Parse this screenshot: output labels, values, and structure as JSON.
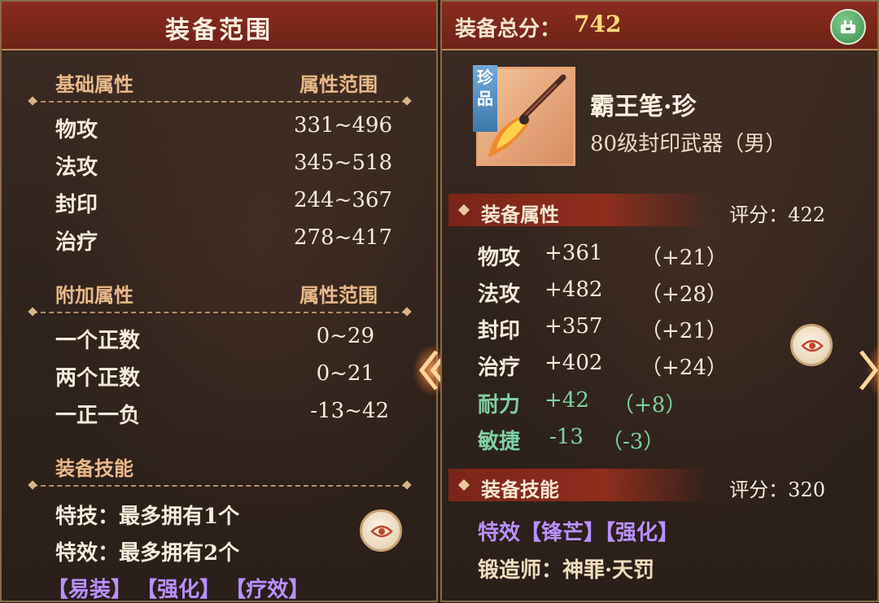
{
  "left_panel": {
    "title": "装备范围",
    "basic": {
      "header_left": "基础属性",
      "header_right": "属性范围",
      "rows": [
        {
          "label": "物攻",
          "value": "331~496"
        },
        {
          "label": "法攻",
          "value": "345~518"
        },
        {
          "label": "封印",
          "value": "244~367"
        },
        {
          "label": "治疗",
          "value": "278~417"
        }
      ]
    },
    "extra": {
      "header_left": "附加属性",
      "header_right": "属性范围",
      "rows": [
        {
          "label": "一个正数",
          "value": "0~29"
        },
        {
          "label": "两个正数",
          "value": "0~21"
        },
        {
          "label": "一正一负",
          "value": "-13~42"
        }
      ]
    },
    "skills": {
      "header": "装备技能",
      "lines": [
        "特技：最多拥有1个",
        "特效：最多拥有2个"
      ],
      "tags": [
        "【易装】",
        "【强化】",
        "【疗效】"
      ]
    }
  },
  "right_panel": {
    "score_label": "装备总分：",
    "score_value": "742",
    "item": {
      "rarity": "珍品",
      "name": "霸王笔·珍",
      "description": "80级封印武器（男）"
    },
    "attributes": {
      "header": "装备属性",
      "score": "评分：422",
      "rows": [
        {
          "label": "物攻",
          "value": "+361",
          "bonus": "（+21）",
          "highlight": false
        },
        {
          "label": "法攻",
          "value": "+482",
          "bonus": "（+28）",
          "highlight": false
        },
        {
          "label": "封印",
          "value": "+357",
          "bonus": "（+21）",
          "highlight": false
        },
        {
          "label": "治疗",
          "value": "+402",
          "bonus": "（+24）",
          "highlight": false
        },
        {
          "label": "耐力",
          "value": "+42",
          "bonus": "（+8）",
          "highlight": true
        },
        {
          "label": "敏捷",
          "value": "-13",
          "bonus": "（-3）",
          "highlight": true
        }
      ]
    },
    "skills": {
      "header": "装备技能",
      "score": "评分：320",
      "effect_line": "特效【锋芒】【强化】",
      "smith_line": "锻造师：神罪·天罚"
    }
  },
  "colors": {
    "header_red": "#8a2c1e",
    "section_gold": "#e8b98a",
    "tag_purple": "#b991ff",
    "stat_green": "#7fd0a5",
    "score_gold": "#ffd67a"
  },
  "icons": [
    "settings-icon",
    "eye-icon",
    "arrow-left-icon",
    "arrow-right-icon",
    "weapon-brush-icon"
  ]
}
